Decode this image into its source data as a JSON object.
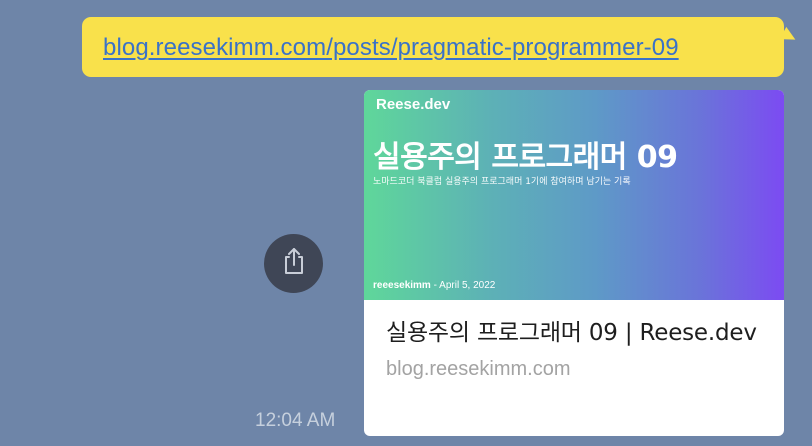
{
  "message": {
    "link_text": "blog.reesekimm.com/posts/pragmatic-programmer-09",
    "timestamp": "12:04 AM"
  },
  "preview_card": {
    "image": {
      "site_name": "Reese.dev",
      "title": "실용주의 프로그래머 09",
      "subtitle": "노마드코더 북클럽 실용주의 프로그래머 1기에 참여하며 남기는 기록",
      "author": "reeesekimm",
      "date": " - April 5, 2022"
    },
    "title": "실용주의 프로그래머 09 | Reese.dev",
    "domain": "blog.reesekimm.com"
  },
  "share_button": {
    "icon": "share-icon"
  },
  "colors": {
    "background": "#6e85a8",
    "bubble": "#f9e14b",
    "link": "#3a72c8",
    "share_button": "#3f4656"
  }
}
